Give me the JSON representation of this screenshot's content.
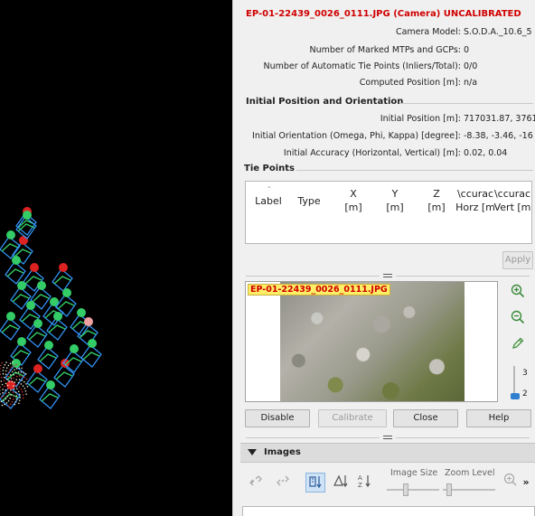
{
  "camera_panel": {
    "title": "EP-01-22439_0026_0111.JPG (Camera) UNCALIBRATED",
    "info": [
      {
        "key": "Camera Model:",
        "value": "S.O.D.A._10.6_5"
      },
      {
        "key": "Number of Marked MTPs and GCPs:",
        "value": "0"
      },
      {
        "key": "Number of Automatic Tie Points (Inliers/Total):",
        "value": "0/0"
      },
      {
        "key": "Computed Position [m]:",
        "value": "n/a"
      }
    ],
    "initial_section": "Initial Position and Orientation",
    "initial": [
      {
        "key": "Initial Position [m]:",
        "value": "717031.87, 3761"
      },
      {
        "key": "Initial Orientation (Omega, Phi, Kappa) [degree]:",
        "value": "-8.38, -3.46, -16"
      },
      {
        "key": "Initial Accuracy (Horizontal, Vertical) [m]:",
        "value": "0.02, 0.04"
      }
    ],
    "tie_points_section": "Tie Points",
    "tie_points_columns": [
      {
        "line1": "Label",
        "line2": ""
      },
      {
        "line1": "Type",
        "line2": ""
      },
      {
        "line1": "X",
        "line2": "[m]"
      },
      {
        "line1": "Y",
        "line2": "[m]"
      },
      {
        "line1": "Z",
        "line2": "[m]"
      },
      {
        "line1": "\\ccurac",
        "line2": "Horz [m"
      },
      {
        "line1": "\\ccurac",
        "line2": "Vert [m"
      }
    ],
    "apply_label": "Apply",
    "image_label": "EP-01-22439_0026_0111.JPG",
    "zoom_ticks": [
      "3",
      "2"
    ],
    "zoom_level": 0.1,
    "buttons": {
      "disable": "Disable",
      "calibrate": "Calibrate",
      "close": "Close",
      "help": "Help"
    }
  },
  "images_panel": {
    "title": "Images",
    "image_size_label": "Image Size",
    "zoom_level_label": "Zoom Level",
    "more_label": "»"
  },
  "icons": {
    "zoom_in": "zoom-in-icon",
    "zoom_out": "zoom-out-icon",
    "pencil": "pencil-icon"
  },
  "colors": {
    "title_red": "#d00000",
    "label_yellow": "#ffee66",
    "camera_green": "#33cc66",
    "camera_blue": "#3399ff",
    "marker_red": "#dd2222",
    "marker_pink": "#f0a0a0"
  }
}
